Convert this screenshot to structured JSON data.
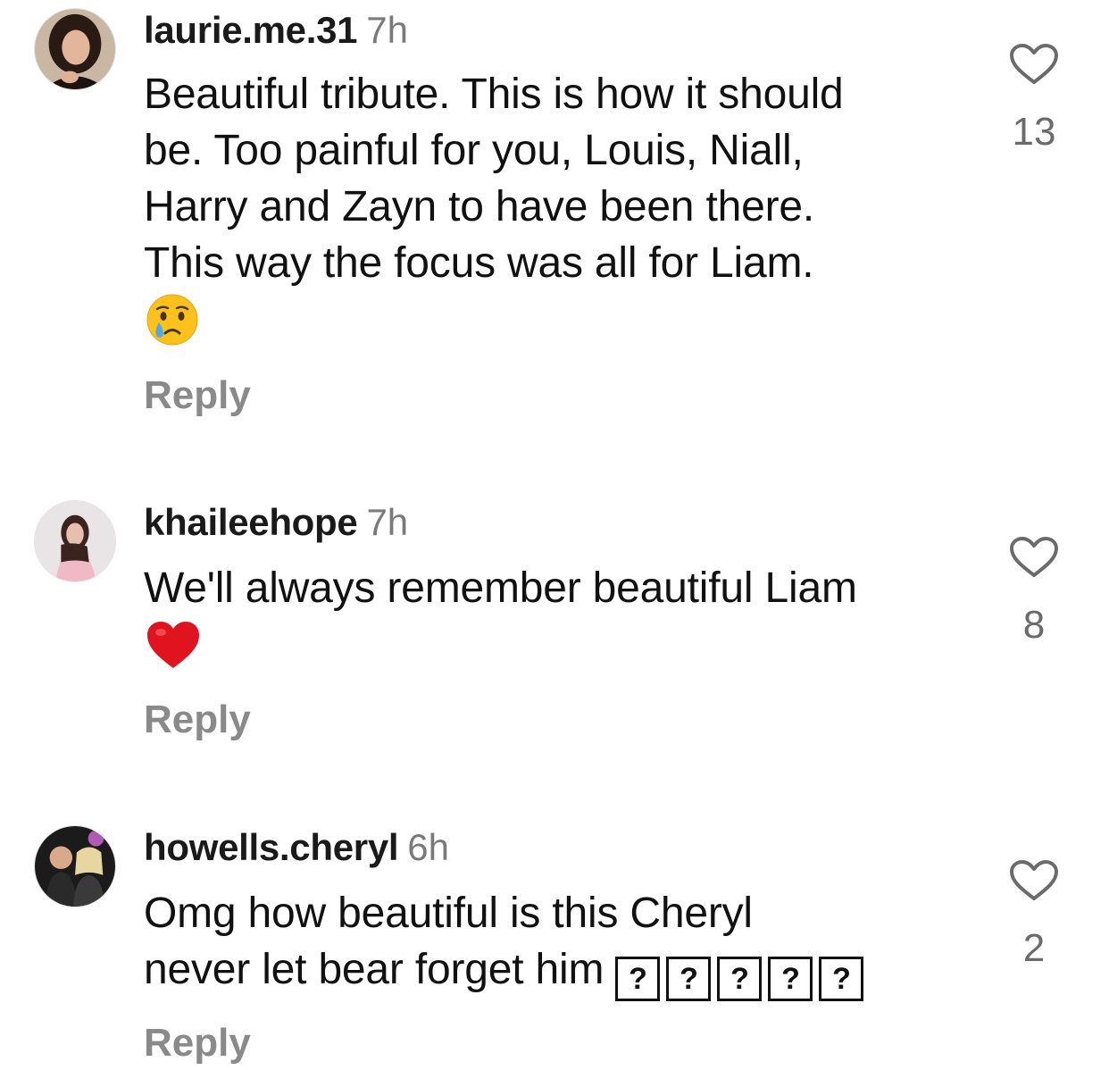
{
  "comments": [
    {
      "username": "laurie.me.31",
      "time": "7h",
      "lines": [
        "Beautiful tribute. This is how it should",
        "be. Too painful for you, Louis, Niall,",
        "Harry and Zayn to have been there.",
        "This way the focus was all for Liam."
      ],
      "emoji": "crying-face",
      "likes": "13",
      "reply": "Reply"
    },
    {
      "username": "khaileehope",
      "time": "7h",
      "lines": [
        "We'll always remember beautiful Liam"
      ],
      "emoji": "red-heart",
      "likes": "8",
      "reply": "Reply"
    },
    {
      "username": "howells.cheryl",
      "time": "6h",
      "lines": [
        "Omg how beautiful is this Cheryl",
        "never let bear forget him"
      ],
      "tofu": [
        "?",
        "?",
        "?",
        "?",
        "?"
      ],
      "likes": "2",
      "reply": "Reply"
    }
  ],
  "icons": {
    "like": "heart-outline-icon"
  },
  "colors": {
    "secondary_text": "#8a8a8a",
    "heart_red": "#e0141e"
  }
}
